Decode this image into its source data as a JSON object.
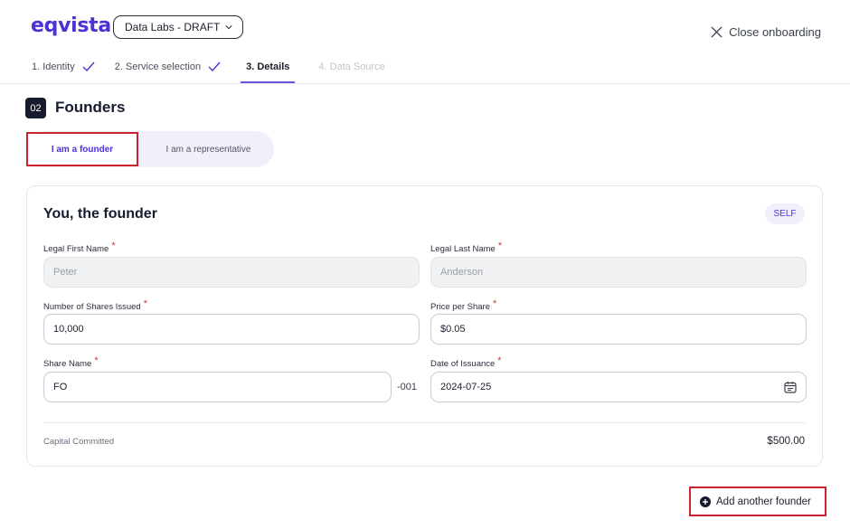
{
  "header": {
    "logo_text": "eqvista",
    "company_select": "Data Labs - DRAFT",
    "close_label": "Close onboarding"
  },
  "steps": [
    {
      "label": "1. Identity",
      "state": "done"
    },
    {
      "label": "2. Service selection",
      "state": "done"
    },
    {
      "label": "3. Details",
      "state": "active"
    },
    {
      "label": "4. Data Source",
      "state": "disabled"
    }
  ],
  "section": {
    "number": "02",
    "title": "Founders"
  },
  "role_toggle": {
    "founder_label": "I am a founder",
    "representative_label": "I am a representative",
    "selected": "founder"
  },
  "card": {
    "title": "You, the founder",
    "badge": "SELF",
    "fields": {
      "first_name": {
        "label": "Legal First Name",
        "value": "Peter"
      },
      "last_name": {
        "label": "Legal Last Name",
        "value": "Anderson"
      },
      "shares_issued": {
        "label": "Number of Shares Issued",
        "value": "10,000"
      },
      "price_per_share": {
        "label": "Price per Share",
        "value": "$0.05"
      },
      "share_name": {
        "label": "Share Name",
        "value": "FO",
        "suffix": "-001"
      },
      "date_of_issuance": {
        "label": "Date of Issuance",
        "value": "2024-07-25"
      }
    },
    "capital_label": "Capital Committed",
    "capital_value": "$500.00"
  },
  "add_founder_label": "Add another founder",
  "colors": {
    "brand": "#4a33d6",
    "highlight": "#c8232f",
    "required": "#d23a3a"
  }
}
